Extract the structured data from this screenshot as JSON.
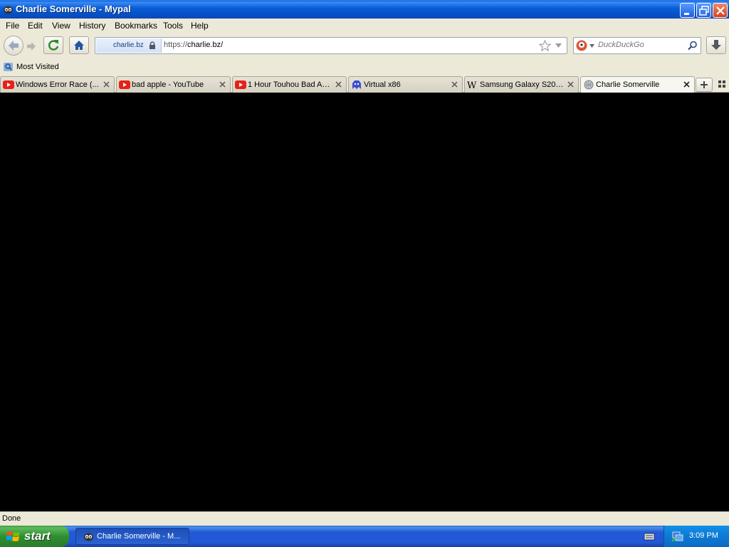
{
  "window": {
    "title": "Charlie Somerville - Mypal"
  },
  "menu": [
    "File",
    "Edit",
    "View",
    "History",
    "Bookmarks",
    "Tools",
    "Help"
  ],
  "nav": {
    "identity_host": "charlie.bz",
    "url_prefix": "https://",
    "url_host": "charlie.bz/",
    "search_placeholder": "DuckDuckGo"
  },
  "bookmarks": {
    "most_visited": "Most Visited"
  },
  "tabs": [
    {
      "label": "Windows Error Race (...",
      "icon": "youtube-icon",
      "active": false
    },
    {
      "label": "bad apple - YouTube",
      "icon": "youtube-icon",
      "active": false
    },
    {
      "label": "1 Hour Touhou Bad Ap...",
      "icon": "youtube-icon",
      "active": false
    },
    {
      "label": "Virtual x86",
      "icon": "virtual-x86-icon",
      "active": false
    },
    {
      "label": "Samsung Galaxy S20 F...",
      "icon": "wikipedia-icon",
      "active": false
    },
    {
      "label": "Charlie Somerville",
      "icon": "globe-icon",
      "active": true
    }
  ],
  "status": {
    "text": "Done"
  },
  "taskbar": {
    "start_label": "start",
    "task_label": "Charlie Somerville - M...",
    "clock": "3:09 PM"
  },
  "colors": {
    "titlebar": "#0a5fd8",
    "chrome": "#ece9d8",
    "content_bg": "#000000",
    "taskbar": "#2459d6",
    "start_green": "#3f9b3f",
    "youtube_red": "#e62117"
  }
}
